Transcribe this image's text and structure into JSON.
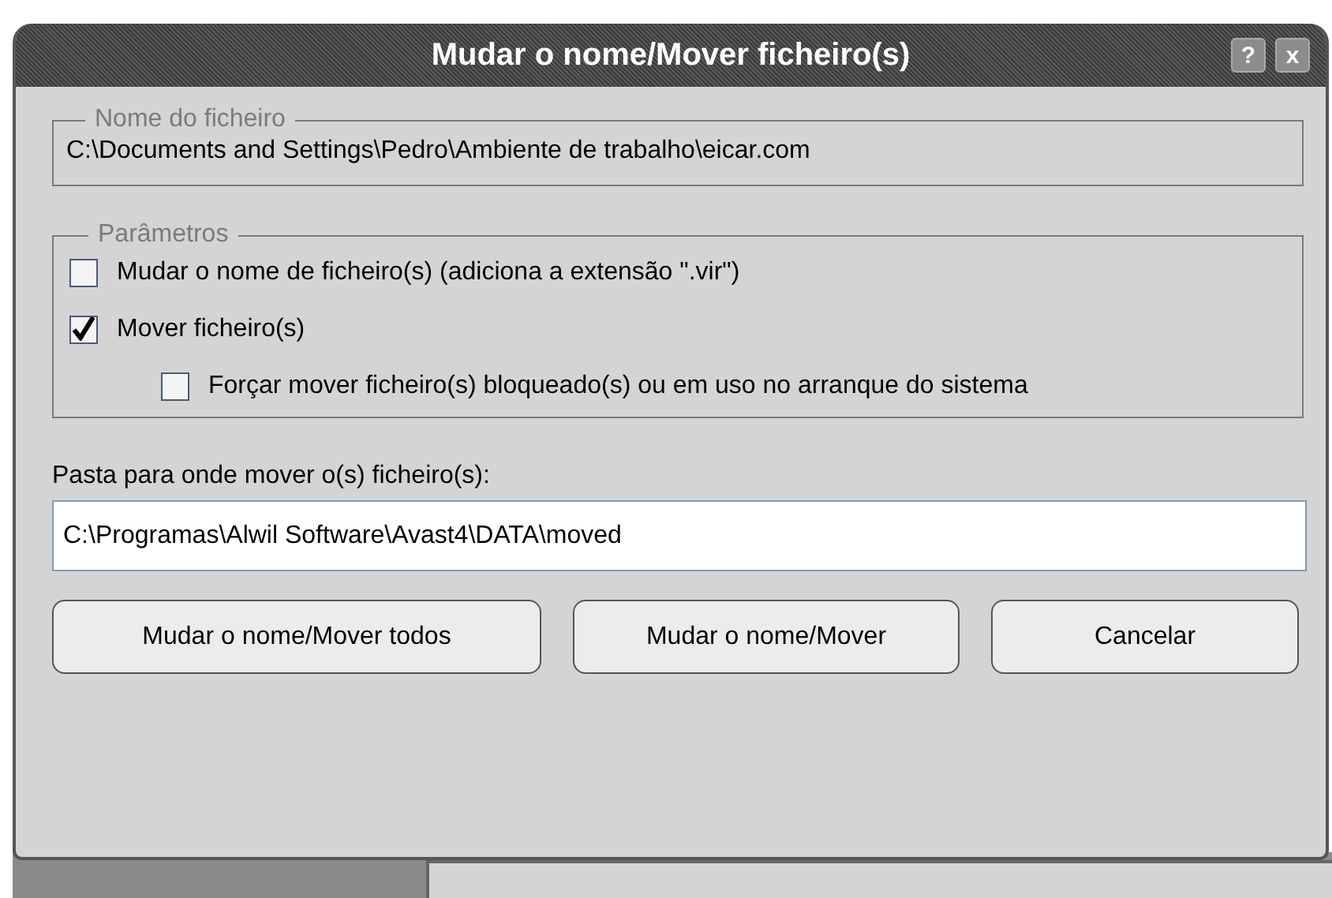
{
  "window": {
    "title": "Mudar o nome/Mover ficheiro(s)",
    "title_buttons": [
      "?",
      "x"
    ]
  },
  "file_group": {
    "legend": "Nome do ficheiro",
    "path": "C:\\Documents and Settings\\Pedro\\Ambiente de trabalho\\eicar.com"
  },
  "parameters": {
    "legend": "Parâmetros",
    "options": [
      {
        "label": "Mudar o nome de ficheiro(s) (adiciona a extensão \".vir\")",
        "checked": false
      },
      {
        "label": "Mover ficheiro(s)",
        "checked": true,
        "children": [
          {
            "label": "Forçar mover ficheiro(s) bloqueado(s) ou em uso no arranque do sistema",
            "checked": false
          }
        ]
      }
    ]
  },
  "destination": {
    "label": "Pasta para onde mover o(s) ficheiro(s):",
    "value": "C:\\Programas\\Alwil Software\\Avast4\\DATA\\moved"
  },
  "buttons": [
    "Mudar o nome/Mover todos",
    "Mudar o nome/Mover",
    "Cancelar"
  ]
}
